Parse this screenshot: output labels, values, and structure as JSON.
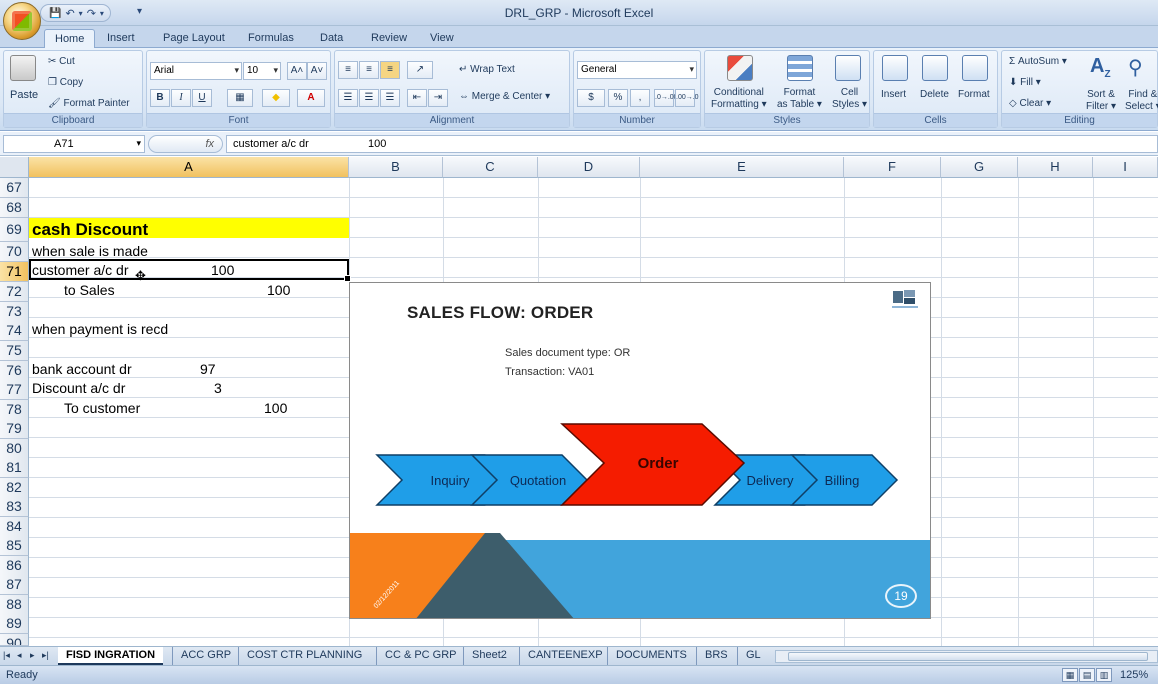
{
  "window": {
    "title": "DRL_GRP - Microsoft Excel"
  },
  "quick_access": {
    "save": "💾",
    "undo": "↶",
    "redo": "↷",
    "more": "▾"
  },
  "ribbon_tabs": [
    "Home",
    "Insert",
    "Page Layout",
    "Formulas",
    "Data",
    "Review",
    "View"
  ],
  "ribbon": {
    "clipboard": {
      "paste": "Paste",
      "cut": "Cut",
      "copy": "Copy",
      "format_painter": "Format Painter",
      "label": "Clipboard"
    },
    "font": {
      "name": "Arial",
      "size": "10",
      "grow": "A˄",
      "shrink": "A˅",
      "bold": "B",
      "italic": "I",
      "underline": "U",
      "borders": "▦",
      "fill": "◆",
      "color": "A",
      "label": "Font"
    },
    "alignment": {
      "wrap_text": "Wrap Text",
      "merge_center": "Merge & Center",
      "label": "Alignment"
    },
    "number": {
      "format": "General",
      "currency": "$",
      "percent": "%",
      "comma": ",",
      "inc_decimal": ".0→.00",
      "dec_decimal": ".00→.0",
      "label": "Number"
    },
    "styles": {
      "conditional": "Conditional",
      "conditional2": "Formatting",
      "format_table": "Format",
      "format_table2": "as Table",
      "cell_styles": "Cell",
      "cell_styles2": "Styles",
      "label": "Styles"
    },
    "cells": {
      "insert": "Insert",
      "delete": "Delete",
      "format": "Format",
      "label": "Cells"
    },
    "editing": {
      "autosum": "AutoSum",
      "fill": "Fill",
      "clear": "Clear",
      "sort": "Sort &",
      "sort2": "Filter",
      "find": "Find &",
      "find2": "Select",
      "label": "Editing"
    }
  },
  "formula_bar": {
    "name_box": "A71",
    "fx": "fx",
    "content": "customer a/c dr",
    "content_value": "100"
  },
  "columns": [
    "A",
    "B",
    "C",
    "D",
    "E",
    "F",
    "G",
    "H",
    "I"
  ],
  "rows": [
    "67",
    "68",
    "69",
    "70",
    "71",
    "72",
    "73",
    "74",
    "75",
    "76",
    "77",
    "78",
    "79",
    "80",
    "81",
    "82",
    "83",
    "84",
    "85",
    "86",
    "87",
    "88",
    "89",
    "90"
  ],
  "cells": {
    "r69": "cash Discount",
    "r70": "when sale is made",
    "r71_text": "customer a/c dr",
    "r71_val": "100",
    "r72_text": "to Sales",
    "r72_val": "100",
    "r74": "when payment is recd",
    "r76_text": "bank account  dr",
    "r76_val": "97",
    "r77_text": "Discount a/c dr",
    "r77_val": "3",
    "r78_text": "To customer",
    "r78_val": "100"
  },
  "slide": {
    "title": "SALES FLOW: ORDER",
    "line1": "Sales document type: OR",
    "line2": "Transaction: VA01",
    "flow": [
      "Inquiry",
      "Quotation",
      "Order",
      "Delivery",
      "Billing"
    ],
    "date": "02/12/2011",
    "page": "19",
    "colors": {
      "blue": "#1f9ee8",
      "red": "#f51c00",
      "orange": "#f7801b",
      "dark": "#3d5d6b",
      "band": "#41a4dc"
    }
  },
  "sheet_tabs": [
    "FISD INGRATION",
    "ACC GRP",
    "COST CTR PLANNING",
    "CC & PC GRP",
    "Sheet2",
    "CANTEENEXP",
    "DOCUMENTS",
    "BRS",
    "GL"
  ],
  "status": {
    "mode": "Ready",
    "zoom": "125%"
  },
  "accent": {
    "header_selected": "#f1c15f",
    "highlight": "#ffff00"
  }
}
